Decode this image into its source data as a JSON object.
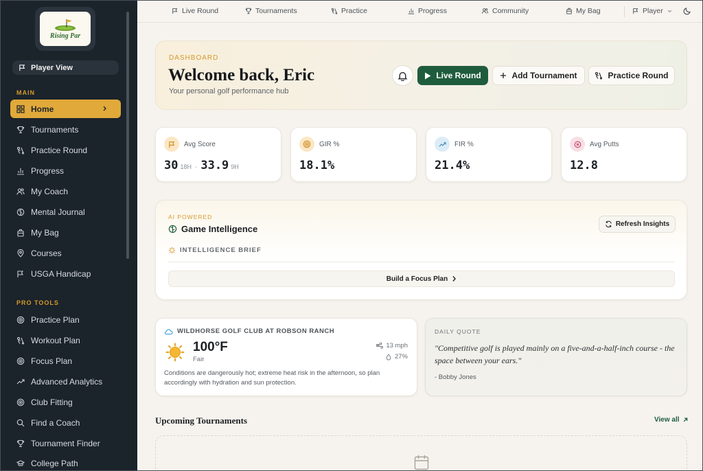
{
  "brand": {
    "name": "Rising Par"
  },
  "sidebar": {
    "player_view": "Player View",
    "sections": {
      "main": "MAIN",
      "pro_tools": "PRO TOOLS"
    },
    "main_items": [
      {
        "label": "Home",
        "icon": "grid-icon",
        "active": true
      },
      {
        "label": "Tournaments",
        "icon": "trophy-icon"
      },
      {
        "label": "Practice Round",
        "icon": "golf-swing-icon"
      },
      {
        "label": "Progress",
        "icon": "bar-chart-icon"
      },
      {
        "label": "My Coach",
        "icon": "users-icon"
      },
      {
        "label": "Mental Journal",
        "icon": "brain-icon"
      },
      {
        "label": "My Bag",
        "icon": "bag-icon"
      },
      {
        "label": "Courses",
        "icon": "map-pin-icon"
      },
      {
        "label": "USGA Handicap",
        "icon": "flag-icon"
      }
    ],
    "pro_items": [
      {
        "label": "Practice Plan",
        "icon": "target-icon"
      },
      {
        "label": "Workout Plan",
        "icon": "golf-swing-icon"
      },
      {
        "label": "Focus Plan",
        "icon": "target-icon"
      },
      {
        "label": "Advanced Analytics",
        "icon": "trending-up-icon"
      },
      {
        "label": "Club Fitting",
        "icon": "target-icon"
      },
      {
        "label": "Find a Coach",
        "icon": "search-icon"
      },
      {
        "label": "Tournament Finder",
        "icon": "trophy-icon"
      },
      {
        "label": "College Path",
        "icon": "graduation-cap-icon"
      }
    ]
  },
  "topnav": {
    "items": [
      {
        "label": "Live Round",
        "icon": "flag-icon"
      },
      {
        "label": "Tournaments",
        "icon": "trophy-icon"
      },
      {
        "label": "Practice",
        "icon": "golf-swing-icon"
      },
      {
        "label": "Progress",
        "icon": "bar-chart-icon"
      },
      {
        "label": "Community",
        "icon": "users-icon"
      },
      {
        "label": "My Bag",
        "icon": "bag-icon"
      }
    ],
    "role": "Player",
    "theme_icon": "moon-icon"
  },
  "hero": {
    "label": "DASHBOARD",
    "title": "Welcome back, Eric",
    "subtitle": "Your personal golf performance hub",
    "buttons": {
      "live_round": "Live Round",
      "add_tournament": "Add Tournament",
      "practice_round": "Practice Round"
    }
  },
  "stats": [
    {
      "label": "Avg Score",
      "value": "30",
      "unit": "18H",
      "value2": "33.9",
      "unit2": "9H",
      "icon": "flag-icon",
      "color": "#fbe7c4"
    },
    {
      "label": "GIR %",
      "value": "18.1%",
      "icon": "target-icon",
      "color": "#fbe7c4"
    },
    {
      "label": "FIR %",
      "value": "21.4%",
      "icon": "trending-up-icon",
      "color": "#dcecf7"
    },
    {
      "label": "Avg Putts",
      "value": "12.8",
      "icon": "crosshair-icon",
      "color": "#f8dfe6"
    }
  ],
  "ai": {
    "label": "AI POWERED",
    "title": "Game Intelligence",
    "refresh": "Refresh Insights",
    "brief": "INTELLIGENCE BRIEF",
    "focus_button": "Build a Focus Plan"
  },
  "weather": {
    "course": "WILDHORSE GOLF CLUB AT ROBSON RANCH",
    "temp": "100°F",
    "condition": "Fair",
    "wind": "13 mph",
    "humidity": "27%",
    "description": "Conditions are dangerously hot; extreme heat risk in the afternoon, so plan accordingly with hydration and sun protection."
  },
  "quote": {
    "label": "DAILY QUOTE",
    "text": "\"Competitive golf is played mainly on a five-and-a-half-inch course - the space between your ears.\"",
    "author": "- Bobby Jones"
  },
  "upcoming": {
    "title": "Upcoming Tournaments",
    "view_all": "View all"
  },
  "colors": {
    "sidebar_bg": "#1b232b",
    "accent": "#e0a93a",
    "primary": "#1f5c3d",
    "page_bg": "#f6f3ee"
  }
}
